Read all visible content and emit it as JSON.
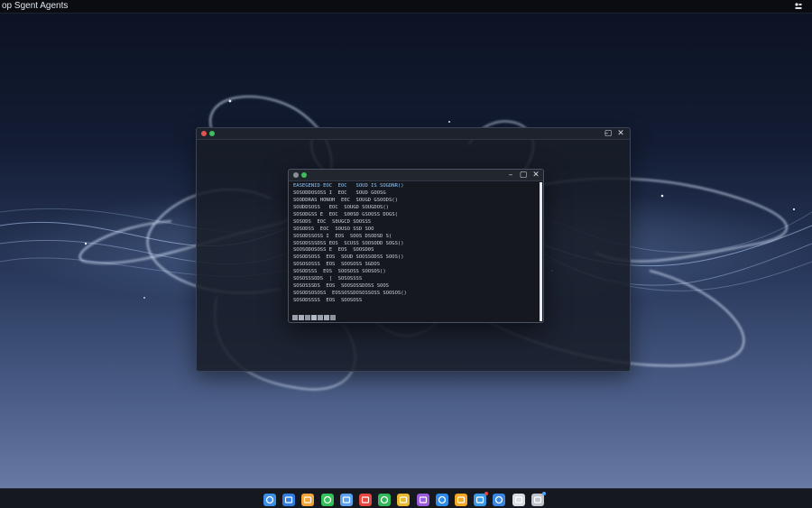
{
  "topbar": {
    "title": "op Sgent Agents",
    "tray_icon": "tray-icon"
  },
  "colors": {
    "accent": "#4aa3ff",
    "close_dot": "#e0564f",
    "max_dot": "#3fbd5a",
    "wave": "#9fc6ff"
  },
  "back_window": {
    "controls": [
      "–",
      "▢",
      "✕"
    ]
  },
  "front_window": {
    "controls": [
      "–",
      "▢",
      "✕"
    ],
    "terminal_lines": [
      "EASEGENID EOC  EOC   SOUD IS SOGDNR()",
      "SOSODDOSOSS I  EOC   SOUD GOOSG",
      "SOODDRAS HONOH  E0C  SOUGD GSOODS()",
      "SOUDDSOSS   EOC  SOUGD SOUGDOS()",
      "SOSODGSS E  EOC  S00SD GSOOSS DOGS(",
      "SOSODS  EOC  S0UGCD SOOSSS",
      "SOSODSS  EOC  SOUSO SSD SOO",
      "SOSODSSOSS I  EOS  SOOS DSODSD S(",
      "SOSODSSSDSS EOS  SCUSS SOOSODD SOGS()",
      "SOOSODOSOSS E  EOS  SOOSD0S",
      "SOSODSOSS  EOS  SOUD SOOSSODSS SOOS()",
      "SOSOSOSSS  EOS  SOOSOSS SGDOS",
      "SOSODSSS  EOS  SOOSOSS SOOSOS()",
      "SOSOSSSODS  [  SOSOSSSS",
      "SOSOSSSDS  EOS  SOOSOSSDOSS SOOS",
      "SOSODSOSOSS  EOSSOSSDOSOSSOSS SOOSOS()",
      "SOSODSSSS  EOS  SOOSOSS",
      "SOSOSSS"
    ],
    "status_colors": [
      "#9aa1ad",
      "#a9b0bb",
      "#8f96a2",
      "#b4bac4",
      "#99a0ab",
      "#a3aab5",
      "#8d94a0"
    ]
  },
  "dock": {
    "items": [
      {
        "name": "finder-icon",
        "color": "#3d8fe6"
      },
      {
        "name": "launchpad-icon",
        "color": "#2f7ee0"
      },
      {
        "name": "notes-icon",
        "color": "#f0a43a"
      },
      {
        "name": "messages-icon",
        "color": "#34c15a"
      },
      {
        "name": "photos-icon",
        "color": "#5aa2f0"
      },
      {
        "name": "calendar-icon",
        "color": "#e5483f"
      },
      {
        "name": "facetime-icon",
        "color": "#32b85a"
      },
      {
        "name": "chrome-icon",
        "color": "#e9b82f"
      },
      {
        "name": "podcasts-icon",
        "color": "#9a5bdc"
      },
      {
        "name": "safari-icon",
        "color": "#2f8ae8"
      },
      {
        "name": "books-icon",
        "color": "#f5a623"
      },
      {
        "name": "maps-icon",
        "color": "#3c9be6"
      },
      {
        "name": "preview-icon",
        "color": "#3a86e0"
      },
      {
        "name": "terminal-icon",
        "color": "#d8dce3"
      },
      {
        "name": "trash-icon",
        "color": "#bfc4cc"
      }
    ]
  }
}
